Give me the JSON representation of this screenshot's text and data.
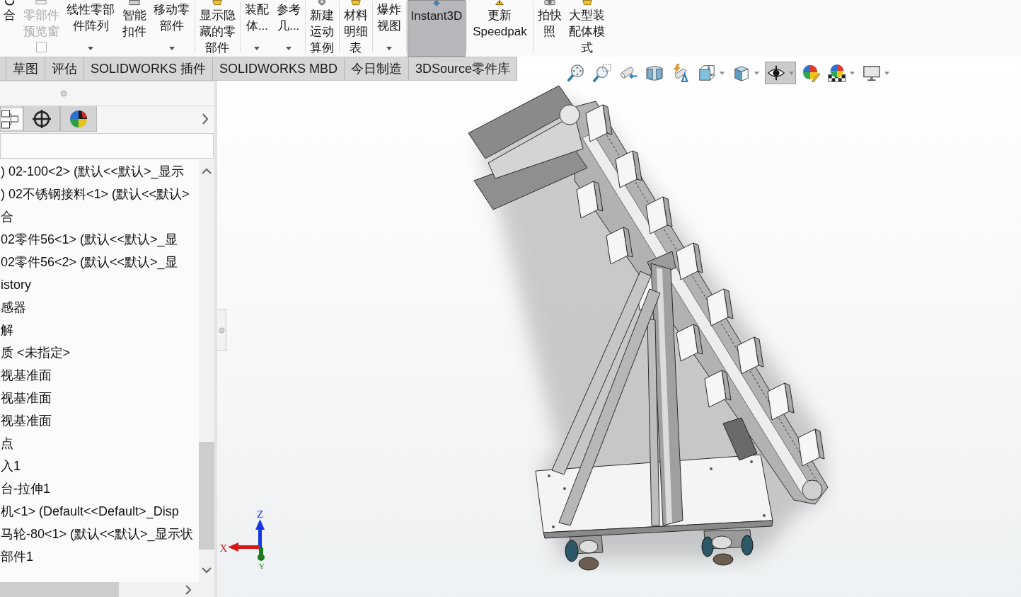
{
  "ribbon": {
    "groups": [
      [
        {
          "label": "合",
          "kind": "button",
          "disabled": false,
          "on": false
        },
        {
          "label": "零部件预览窗",
          "kind": "checkbox",
          "checked": false,
          "disabled": true,
          "on": false
        },
        {
          "label": "线性零部件阵列",
          "kind": "dropdown",
          "disabled": false,
          "on": false
        },
        {
          "label": "智能扣件",
          "kind": "button",
          "disabled": false,
          "on": false
        },
        {
          "label": "移动零部件",
          "kind": "dropdown",
          "disabled": false,
          "on": false
        }
      ],
      [
        {
          "label": "显示隐藏的零部件",
          "kind": "button",
          "disabled": false,
          "on": false
        }
      ],
      [
        {
          "label": "装配体...",
          "kind": "dropdown",
          "disabled": false,
          "on": false
        },
        {
          "label": "参考几...",
          "kind": "dropdown",
          "disabled": false,
          "on": false
        }
      ],
      [
        {
          "label": "新建运动算例",
          "kind": "button",
          "disabled": false,
          "on": false
        }
      ],
      [
        {
          "label": "材料明细表",
          "kind": "button",
          "disabled": false,
          "on": false
        }
      ],
      [
        {
          "label": "爆炸视图",
          "kind": "dropdown",
          "disabled": false,
          "on": false
        }
      ],
      [
        {
          "label": "Instant3D",
          "kind": "button",
          "disabled": false,
          "on": true
        }
      ],
      [
        {
          "label": "更新Speedpak",
          "kind": "button",
          "disabled": false,
          "on": false
        }
      ],
      [
        {
          "label": "拍快照",
          "kind": "button",
          "disabled": false,
          "on": false
        },
        {
          "label": "大型装配体模式",
          "kind": "button",
          "disabled": false,
          "on": false
        }
      ]
    ]
  },
  "command_tabs": [
    {
      "label": "草图",
      "selected": false
    },
    {
      "label": "评估",
      "selected": false
    },
    {
      "label": "SOLIDWORKS 插件",
      "selected": false
    },
    {
      "label": "SOLIDWORKS MBD",
      "selected": false
    },
    {
      "label": "今日制造",
      "selected": false
    },
    {
      "label": "3DSource零件库",
      "selected": false
    }
  ],
  "view_toolbar": [
    {
      "dropdown": false,
      "pressed": false
    },
    {
      "dropdown": false,
      "pressed": false
    },
    {
      "dropdown": false,
      "pressed": false
    },
    {
      "dropdown": false,
      "pressed": false
    },
    {
      "dropdown": false,
      "pressed": false
    },
    {
      "dropdown": true,
      "pressed": false
    },
    {
      "dropdown": true,
      "pressed": false
    },
    {
      "dropdown": true,
      "pressed": true
    },
    {
      "dropdown": false,
      "pressed": false
    },
    {
      "dropdown": true,
      "pressed": false
    },
    {
      "dropdown": true,
      "pressed": false
    }
  ],
  "feature_tree": {
    "rows": [
      {
        "text": ") 02-100<2> (默认<<默认>_显示"
      },
      {
        "text": ") 02不锈钢接料<1> (默认<<默认>"
      },
      {
        "text": "合"
      },
      {
        "text": "02零件56<1> (默认<<默认>_显"
      },
      {
        "text": "02零件56<2> (默认<<默认>_显"
      },
      {
        "text": "istory"
      },
      {
        "text": "感器"
      },
      {
        "text": "解"
      },
      {
        "text": "质 <未指定>"
      },
      {
        "text": "视基准面"
      },
      {
        "text": "视基准面"
      },
      {
        "text": "视基准面"
      },
      {
        "text": "点"
      },
      {
        "text": "入1"
      },
      {
        "text": "台-拉伸1"
      },
      {
        "text": "机<1> (Default<<Default>_Disp"
      },
      {
        "text": "马轮-80<1> (默认<<默认>_显示状"
      },
      {
        "text": "部件1"
      }
    ]
  },
  "triad": {
    "axes": [
      {
        "kind": "z",
        "label": "Z",
        "color": "#1436e6"
      },
      {
        "kind": "x",
        "label": "X",
        "color": "#d81818"
      },
      {
        "kind": "y",
        "label": "Y",
        "color": "#1e7a22"
      }
    ]
  }
}
